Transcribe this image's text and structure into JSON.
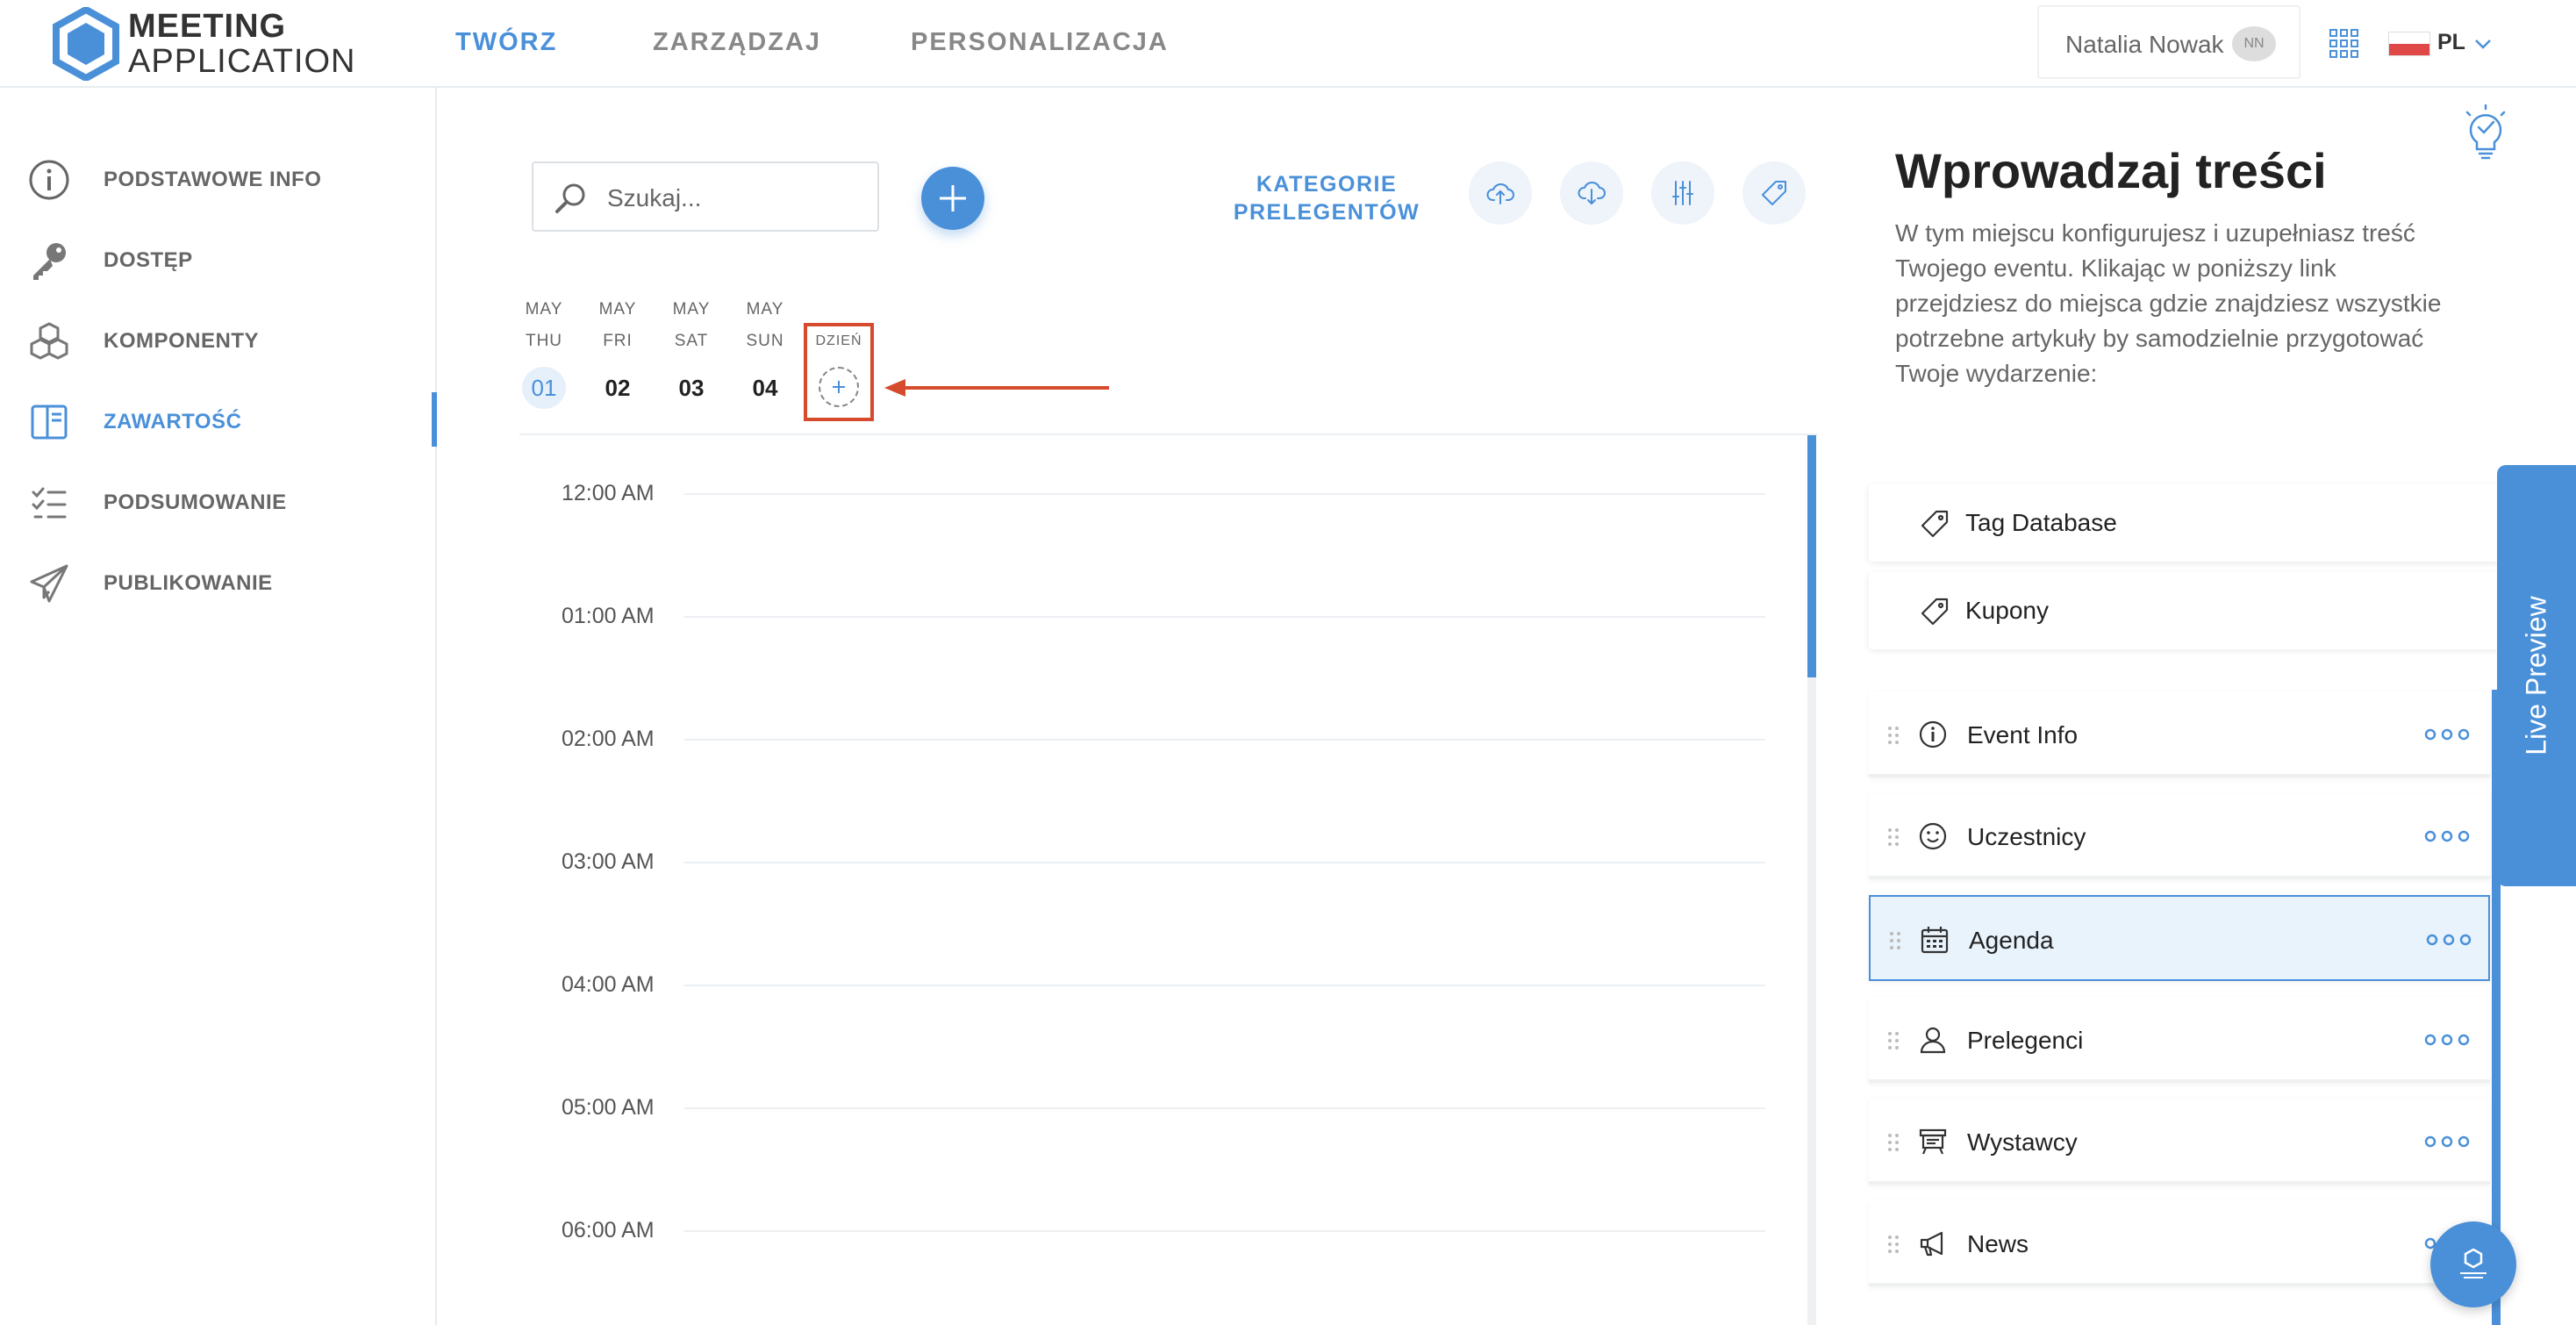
{
  "brand": {
    "line1": "MEETING",
    "line2": "APPLICATION"
  },
  "nav": {
    "items": [
      "TWÓRZ",
      "ZARZĄDZAJ",
      "PERSONALIZACJA"
    ],
    "active_index": 0
  },
  "user": {
    "name": "Natalia Nowak",
    "initials": "NN"
  },
  "language": {
    "code": "PL"
  },
  "sidebar": {
    "items": [
      {
        "label": "PODSTAWOWE INFO",
        "icon": "info-icon"
      },
      {
        "label": "DOSTĘP",
        "icon": "key-icon"
      },
      {
        "label": "KOMPONENTY",
        "icon": "cubes-icon"
      },
      {
        "label": "ZAWARTOŚĆ",
        "icon": "content-panel-icon"
      },
      {
        "label": "PODSUMOWANIE",
        "icon": "checklist-icon"
      },
      {
        "label": "PUBLIKOWANIE",
        "icon": "paper-plane-icon"
      }
    ],
    "active_index": 3
  },
  "toolbar": {
    "search_placeholder": "Szukaj...",
    "category_link_line1": "KATEGORIE",
    "category_link_line2": "PRELEGENTÓW",
    "buttons": [
      "upload-icon",
      "download-icon",
      "sliders-icon",
      "tag-icon"
    ]
  },
  "days": [
    {
      "month": "MAY",
      "weekday": "THU",
      "day": "01",
      "active": true
    },
    {
      "month": "MAY",
      "weekday": "FRI",
      "day": "02",
      "active": false
    },
    {
      "month": "MAY",
      "weekday": "SAT",
      "day": "03",
      "active": false
    },
    {
      "month": "MAY",
      "weekday": "SUN",
      "day": "04",
      "active": false
    }
  ],
  "add_day": {
    "label": "DZIEŃ"
  },
  "timeline": {
    "times": [
      "12:00 AM",
      "01:00 AM",
      "02:00 AM",
      "03:00 AM",
      "04:00 AM",
      "05:00 AM",
      "06:00 AM"
    ]
  },
  "panel": {
    "title": "Wprowadzaj treści",
    "description": "W tym miejscu konfigurujesz i uzupełniasz treść Twojego eventu. Klikając w poniższy link przejdziesz do miejsca gdzie znajdziesz wszystkie potrzebne artykuły by samodzielnie przygotować Twoje wydarzenie:",
    "tag_cards": [
      "Tag Database",
      "Kupony"
    ],
    "modules": [
      {
        "label": "Event Info",
        "icon": "info-icon",
        "active": false
      },
      {
        "label": "Uczestnicy",
        "icon": "smile-icon",
        "active": false
      },
      {
        "label": "Agenda",
        "icon": "calendar-icon",
        "active": true
      },
      {
        "label": "Prelegenci",
        "icon": "person-icon",
        "active": false
      },
      {
        "label": "Wystawcy",
        "icon": "booth-icon",
        "active": false
      },
      {
        "label": "News",
        "icon": "megaphone-icon",
        "active": false
      }
    ]
  },
  "live_preview": {
    "label": "Live Preview"
  },
  "colors": {
    "accent": "#4a90d9",
    "highlight_box": "#d64a2e",
    "active_card_bg": "#e8f3fc"
  }
}
